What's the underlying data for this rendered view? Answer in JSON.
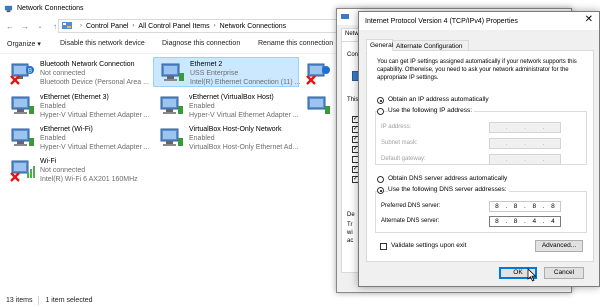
{
  "explorer": {
    "title": "Network Connections",
    "breadcrumb": [
      "Control Panel",
      "All Control Panel Items",
      "Network Connections"
    ],
    "toolbar": {
      "organize": "Organize",
      "disable": "Disable this network device",
      "diagnose": "Diagnose this connection",
      "rename": "Rename this connection"
    },
    "connections": [
      {
        "name": "Bluetooth Network Connection",
        "status": "Not connected",
        "device": "Bluetooth Device (Personal Area ..."
      },
      {
        "name": "Ethernet 2",
        "status": "USS Enterprise",
        "device": "Intel(R) Ethernet Connection (11) ..."
      },
      {
        "name": "vEthernet (Ethernet 3)",
        "status": "Enabled",
        "device": "Hyper-V Virtual Ethernet Adapter ..."
      },
      {
        "name": "vEthernet (VirtualBox Host)",
        "status": "Enabled",
        "device": "Hyper-V Virtual Ethernet Adapter ..."
      },
      {
        "name": "vEthernet (Wi-Fi)",
        "status": "Enabled",
        "device": "Hyper-V Virtual Ethernet Adapter ..."
      },
      {
        "name": "VirtualBox Host-Only Network",
        "status": "Enabled",
        "device": "VirtualBox Host-Only Ethernet Ad..."
      },
      {
        "name": "Wi-Fi",
        "status": "Not connected",
        "device": "Intel(R) Wi-Fi 6 AX201 160MHz"
      }
    ],
    "status": {
      "count": "13 items",
      "selected": "1 item selected"
    }
  },
  "eth_dialog": {
    "tab": "Netw",
    "labels": [
      "Conn",
      "This",
      "De",
      "Tr",
      "wi",
      "ac"
    ]
  },
  "ipv4": {
    "title": "Internet Protocol Version 4 (TCP/IPv4) Properties",
    "tabs": [
      "General",
      "Alternate Configuration"
    ],
    "description": "You can get IP settings assigned automatically if your network supports this capability. Otherwise, you need to ask your network administrator for the appropriate IP settings.",
    "ip_auto": "Obtain an IP address automatically",
    "ip_manual": "Use the following IP address:",
    "ip_address_label": "IP address:",
    "subnet_label": "Subnet mask:",
    "gateway_label": "Default gateway:",
    "dns_auto": "Obtain DNS server address automatically",
    "dns_manual": "Use the following DNS server addresses:",
    "preferred_label": "Preferred DNS server:",
    "alternate_label": "Alternate DNS server:",
    "preferred_dns": [
      "8",
      "8",
      "8",
      "8"
    ],
    "alternate_dns": [
      "8",
      "8",
      "4",
      "4"
    ],
    "validate_label": "Validate settings upon exit",
    "advanced_label": "Advanced...",
    "ok_label": "OK",
    "cancel_label": "Cancel"
  }
}
